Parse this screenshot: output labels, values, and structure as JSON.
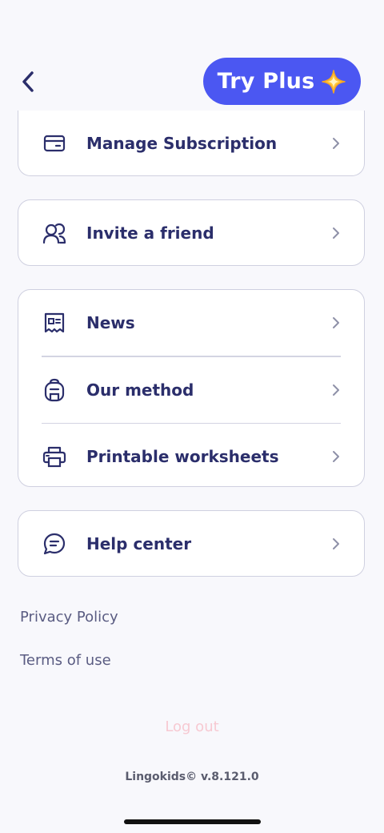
{
  "header": {
    "back_icon": "chevron-left-icon",
    "try_plus_label": "Try Plus",
    "try_plus_icon": "sparkle-icon",
    "accent_color": "#4b57f2"
  },
  "cards": {
    "subscription": {
      "label": "Manage Subscription",
      "icon": "credit-card-icon"
    },
    "invite": {
      "label": "Invite a friend",
      "icon": "users-icon"
    },
    "news": {
      "label": "News",
      "icon": "newspaper-icon"
    },
    "method": {
      "label": "Our method",
      "icon": "backpack-icon"
    },
    "worksheets": {
      "label": "Printable worksheets",
      "icon": "printer-icon"
    },
    "help": {
      "label": "Help center",
      "icon": "chat-bubble-icon"
    }
  },
  "links": {
    "privacy": "Privacy Policy",
    "terms": "Terms of use"
  },
  "logout_label": "Log out",
  "version_text": "Lingokids© v.8.121.0"
}
